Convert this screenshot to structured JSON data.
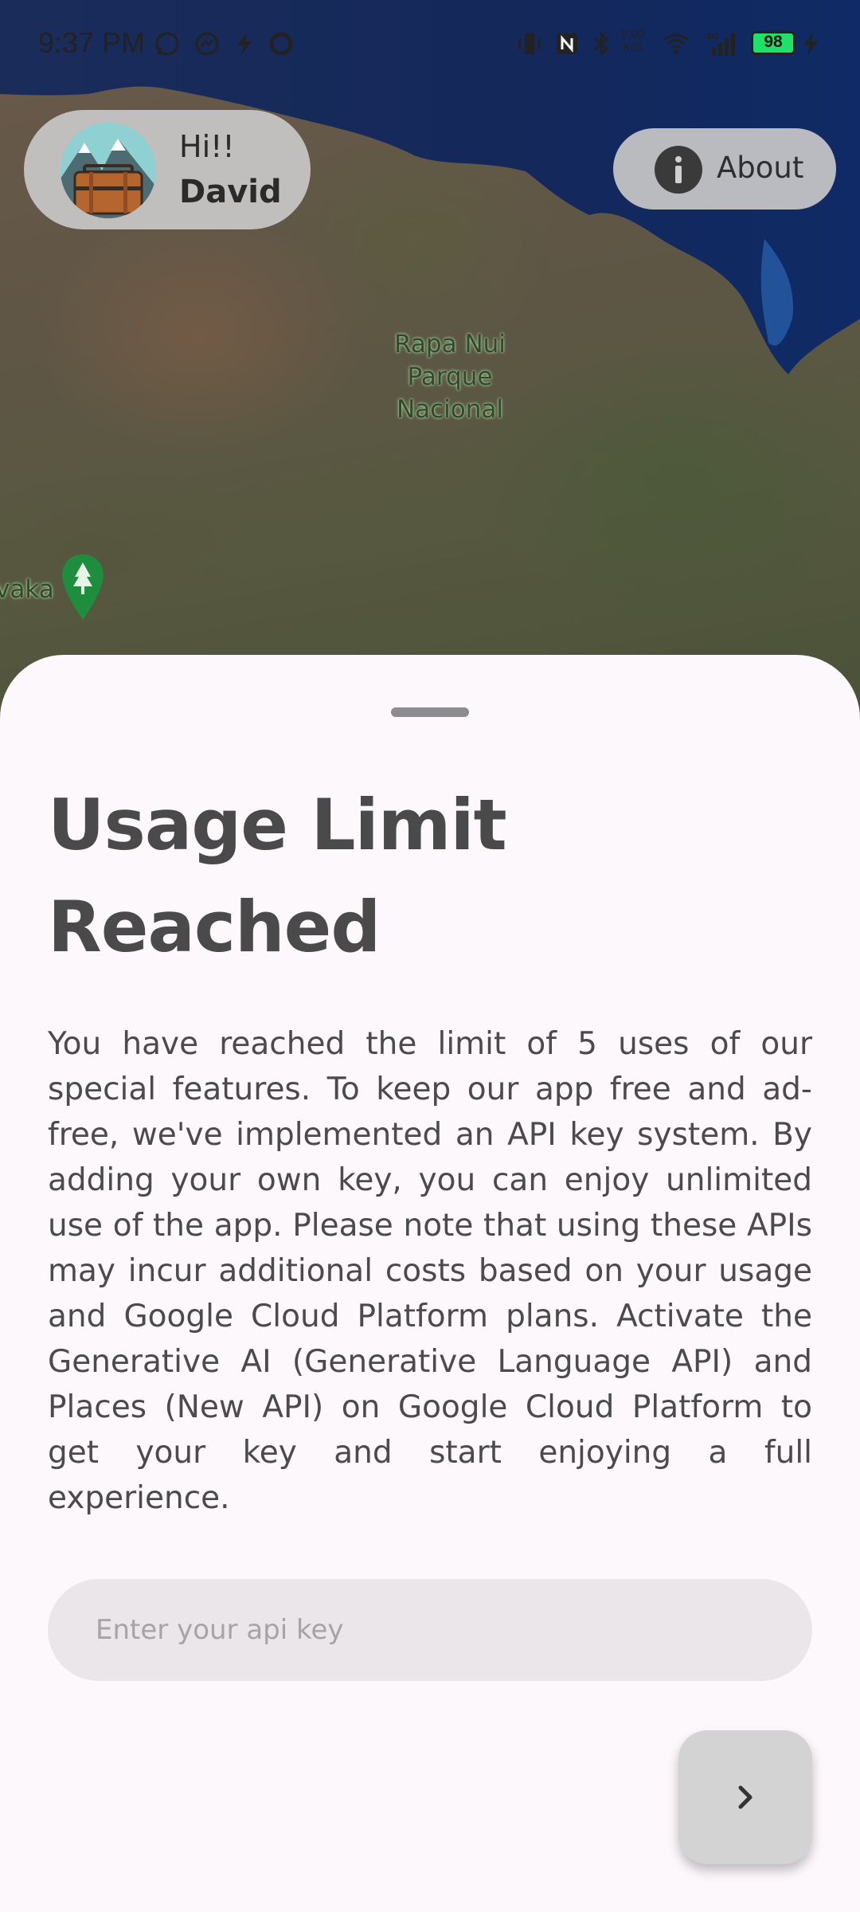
{
  "status_bar": {
    "time": "9:37 PM",
    "battery": "98",
    "speed": "0.00\nK/S",
    "icons": [
      "whatsapp-icon",
      "messenger-icon",
      "bolt-icon",
      "circle-icon",
      "vibrate-icon",
      "nfc-icon",
      "bluetooth-icon",
      "wifi-icon",
      "signal-4g-icon",
      "charging-icon"
    ]
  },
  "map": {
    "park_label": "Rapa Nui\nParque\nNacional",
    "place_label": "vaka"
  },
  "profile": {
    "greeting": "Hi!!",
    "name": "David"
  },
  "about": {
    "label": "About"
  },
  "sheet": {
    "title": "Usage Limit Reached",
    "body": "You have reached the limit of 5 uses of our special features. To keep our app free and ad-free, we've implemented an API key system. By adding your own key, you can enjoy unlimited use of the app. Please note that using these APIs may incur additional costs based on your usage and Google Cloud Platform plans. Activate the Generative AI (Generative Language API) and Places (New API) on Google Cloud Platform to get your key and start enjoying a full experience.",
    "input_placeholder": "Enter your api key",
    "input_value": ""
  },
  "colors": {
    "sheet_bg": "#fdf8fc",
    "battery": "#1ee06a",
    "pill_bg": "#c8c8c8"
  }
}
